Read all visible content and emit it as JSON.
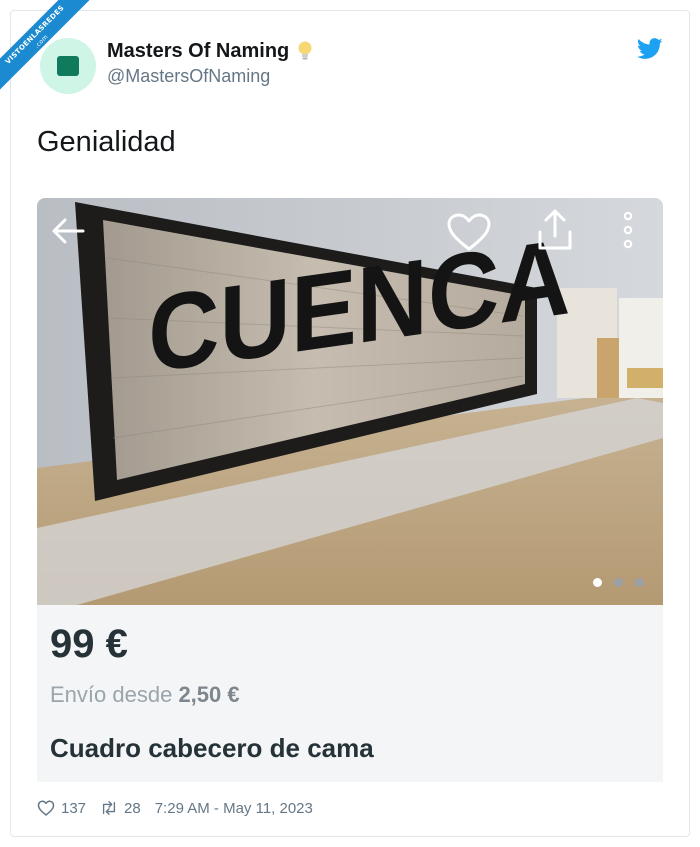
{
  "watermark": {
    "text": "VISTOENLASREDES",
    "sub": ".com"
  },
  "tweet": {
    "display_name": "Masters Of Naming",
    "handle": "@MastersOfNaming",
    "text": "Genialidad",
    "likes": "137",
    "retweets": "28",
    "timestamp": "7:29 AM - May 11, 2023"
  },
  "photo": {
    "sign_text": "CUENCA"
  },
  "listing": {
    "price": "99 €",
    "shipping_prefix": "Envío desde",
    "shipping_amount": "2,50 €",
    "title": "Cuadro cabecero de cama"
  },
  "icons": {
    "verified_emoji": "light-bulb-icon",
    "brand": "twitter-bird-icon",
    "back": "arrow-left-icon",
    "favorite": "heart-outline-icon",
    "share": "share-upload-icon",
    "more": "more-vertical-icon",
    "like": "heart-icon",
    "retweet": "retweet-icon"
  },
  "colors": {
    "twitter_blue": "#1da1f2",
    "ribbon": "#1b8ad0",
    "avatar_bg": "#cef5e6"
  }
}
